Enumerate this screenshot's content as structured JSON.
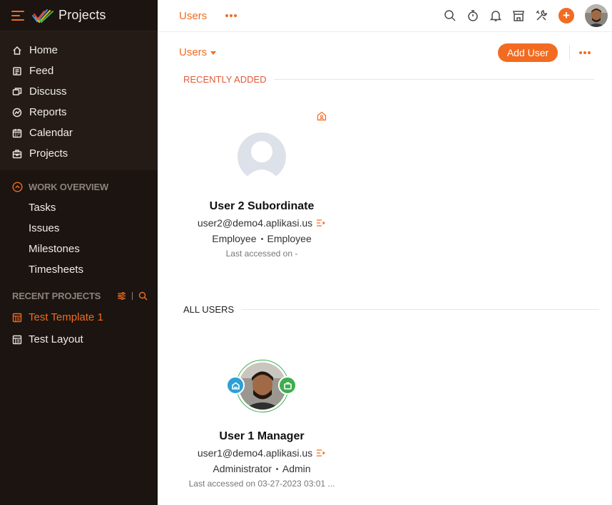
{
  "app": {
    "title": "Projects"
  },
  "sidebar": {
    "nav": [
      {
        "label": "Home",
        "icon": "home-icon"
      },
      {
        "label": "Feed",
        "icon": "feed-icon"
      },
      {
        "label": "Discuss",
        "icon": "discuss-icon"
      },
      {
        "label": "Reports",
        "icon": "reports-icon"
      },
      {
        "label": "Calendar",
        "icon": "calendar-icon"
      },
      {
        "label": "Projects",
        "icon": "projects-icon"
      }
    ],
    "work_overview": {
      "title": "WORK OVERVIEW",
      "items": [
        "Tasks",
        "Issues",
        "Milestones",
        "Timesheets"
      ]
    },
    "recent_projects": {
      "title": "RECENT PROJECTS",
      "items": [
        {
          "label": "Test Template 1",
          "active": true
        },
        {
          "label": "Test Layout",
          "active": false
        }
      ]
    }
  },
  "topbar": {
    "tab": "Users"
  },
  "subbar": {
    "dropdown": "Users",
    "add_button": "Add User"
  },
  "sections": {
    "recent": "RECENTLY ADDED",
    "all": "ALL USERS"
  },
  "users": [
    {
      "name": "User 2 Subordinate",
      "email": "user2@demo4.aplikasi.us",
      "role": "Employee",
      "profile": "Employee",
      "last_access": "Last accessed on -"
    },
    {
      "name": "User 1 Manager",
      "email": "user1@demo4.aplikasi.us",
      "role": "Administrator",
      "profile": "Admin",
      "last_access": "Last accessed on 03-27-2023 03:01 ..."
    }
  ],
  "colors": {
    "accent": "#f26b21",
    "sidebar_bg": "#1b1410",
    "sidebar_upper_bg": "#241b16",
    "badge_blue": "#2e9fd6",
    "badge_green": "#3dae4e"
  }
}
